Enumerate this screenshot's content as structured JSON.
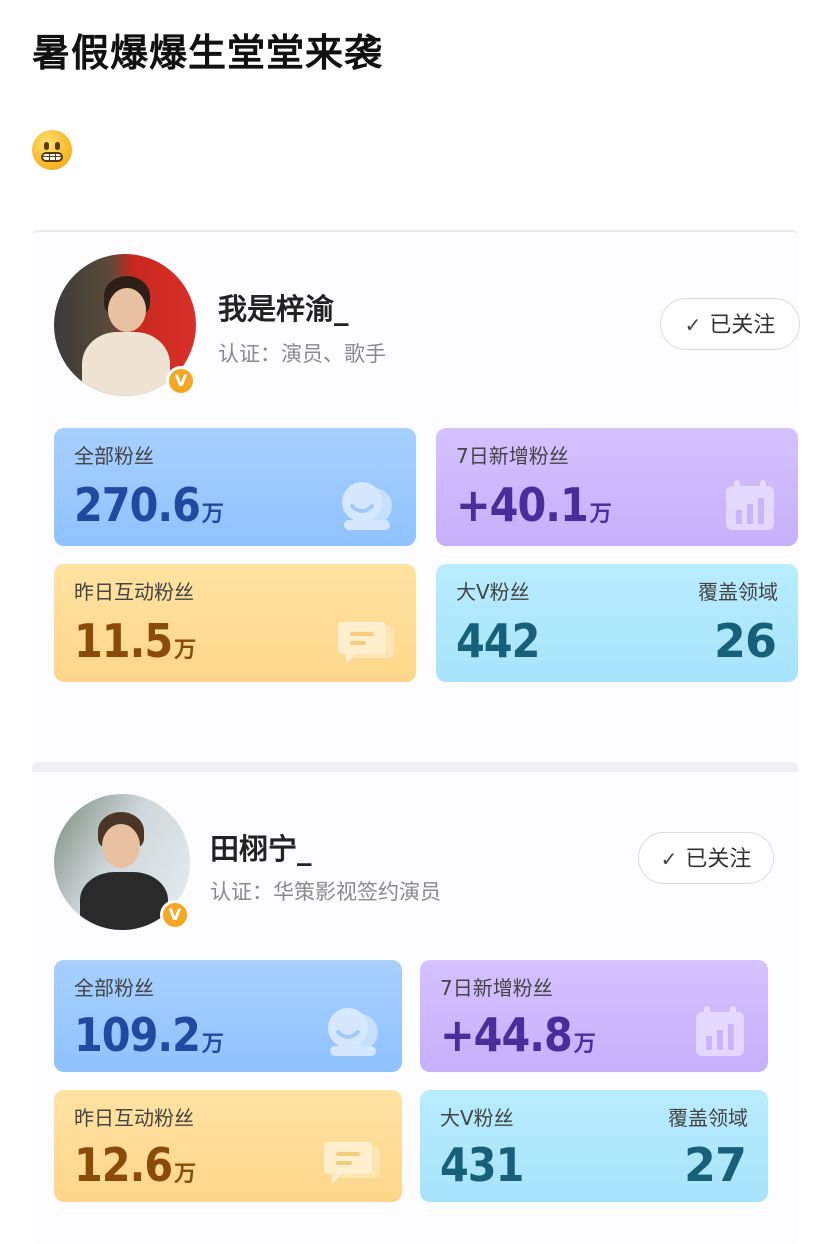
{
  "post": {
    "title": "暑假爆爆生堂堂来袭",
    "emoji": "grimacing-face"
  },
  "accounts": [
    {
      "name": "我是梓渝_",
      "certification": "认证：演员、歌手",
      "follow_label": "已关注",
      "stats": {
        "total_fans": {
          "label": "全部粉丝",
          "value": "270.6",
          "unit": "万"
        },
        "new_fans_7d": {
          "label": "7日新增粉丝",
          "value": "+40.1",
          "unit": "万"
        },
        "interactive_fans_yesterday": {
          "label": "昨日互动粉丝",
          "value": "11.5",
          "unit": "万"
        },
        "bigv_fans": {
          "label": "大V粉丝",
          "value": "442"
        },
        "coverage_fields": {
          "label": "覆盖领域",
          "value": "26"
        }
      }
    },
    {
      "name": "田栩宁_",
      "certification": "认证：华策影视签约演员",
      "follow_label": "已关注",
      "stats": {
        "total_fans": {
          "label": "全部粉丝",
          "value": "109.2",
          "unit": "万"
        },
        "new_fans_7d": {
          "label": "7日新增粉丝",
          "value": "+44.8",
          "unit": "万"
        },
        "interactive_fans_yesterday": {
          "label": "昨日互动粉丝",
          "value": "12.6",
          "unit": "万"
        },
        "bigv_fans": {
          "label": "大V粉丝",
          "value": "431"
        },
        "coverage_fields": {
          "label": "覆盖领域",
          "value": "27"
        }
      }
    }
  ],
  "colors": {
    "blue_tile": "#9fcbff",
    "purple_tile": "#cfbcff",
    "orange_tile": "#fedc95",
    "cyan_tile": "#b0e8fd",
    "verified_badge": "#f5a623"
  }
}
